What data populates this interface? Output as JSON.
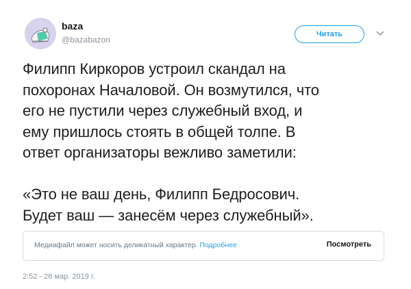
{
  "author": {
    "name": "baza",
    "handle": "@bazabazon",
    "avatar_icon": "avatar-icon"
  },
  "actions": {
    "follow_label": "Читать",
    "more_icon": "chevron-down-icon"
  },
  "tweet": {
    "text": "Филипп Киркоров устроил скандал на\nпохоронах Началовой. Он возмутился, что\nего не пустили через служебный вход, и\nему пришлось стоять в общей толпе. В\nответ организаторы вежливо заметили:\n\n«Это не ваш день, Филипп Бедросович.\nБудет ваш — занесём через служебный».",
    "timestamp": "2:52 - 26 мар. 2019 г."
  },
  "media_warning": {
    "text": "Медиафайл может носить деликатный характер.",
    "link_label": "Подробнее",
    "view_label": "Посмотреть"
  },
  "colors": {
    "accent": "#1da1f2",
    "secondary_text": "#8a939b"
  }
}
